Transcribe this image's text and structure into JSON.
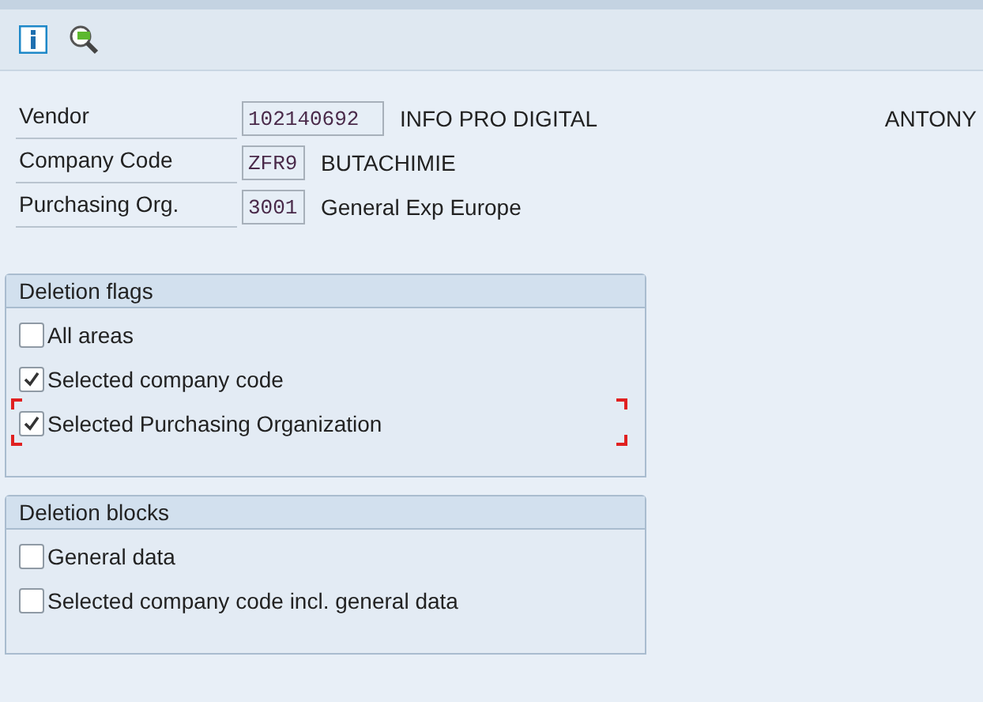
{
  "toolbar": {
    "buttons": [
      {
        "kind": "info"
      },
      {
        "kind": "search"
      }
    ]
  },
  "fields": [
    {
      "label": "Vendor",
      "value": "102140692",
      "description": "INFO PRO DIGITAL",
      "extra": "ANTONY"
    },
    {
      "label": "Company Code",
      "value": "ZFR9",
      "description": "BUTACHIMIE"
    },
    {
      "label": "Purchasing Org.",
      "value": "3001",
      "description": "General Exp Europe"
    }
  ],
  "groups": [
    {
      "title": "Deletion flags",
      "items": [
        {
          "label": "All areas",
          "checked": false,
          "focused": false
        },
        {
          "label": "Selected company code",
          "checked": true,
          "focused": false
        },
        {
          "label": "Selected Purchasing Organization",
          "checked": true,
          "focused": true
        }
      ]
    },
    {
      "title": "Deletion blocks",
      "items": [
        {
          "label": "General data",
          "checked": false,
          "focused": false
        },
        {
          "label": "Selected company code incl. general data",
          "checked": false,
          "focused": false
        }
      ]
    }
  ]
}
